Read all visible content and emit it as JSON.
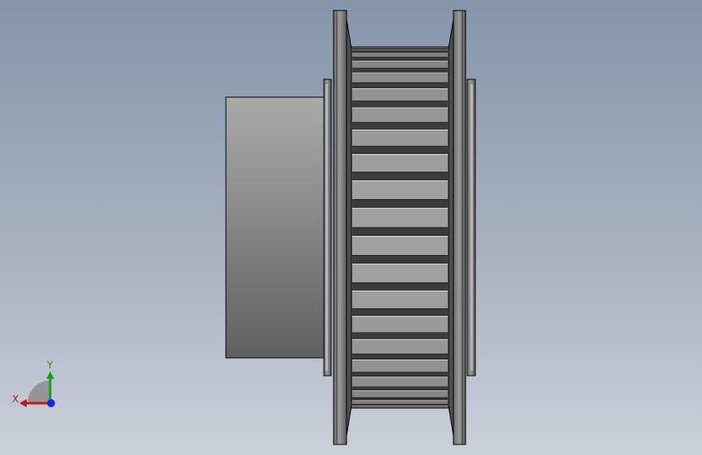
{
  "viewport": {
    "background_top": "#8695ab",
    "background_bottom": "#cbd0d9"
  },
  "model": {
    "type": "timing-pulley",
    "view": "side",
    "tooth_count_visible": 20
  },
  "triad": {
    "x_label": "X",
    "y_label": "Y",
    "x_color": "#c01818",
    "y_color": "#10a020",
    "z_color": "#1030d0"
  }
}
